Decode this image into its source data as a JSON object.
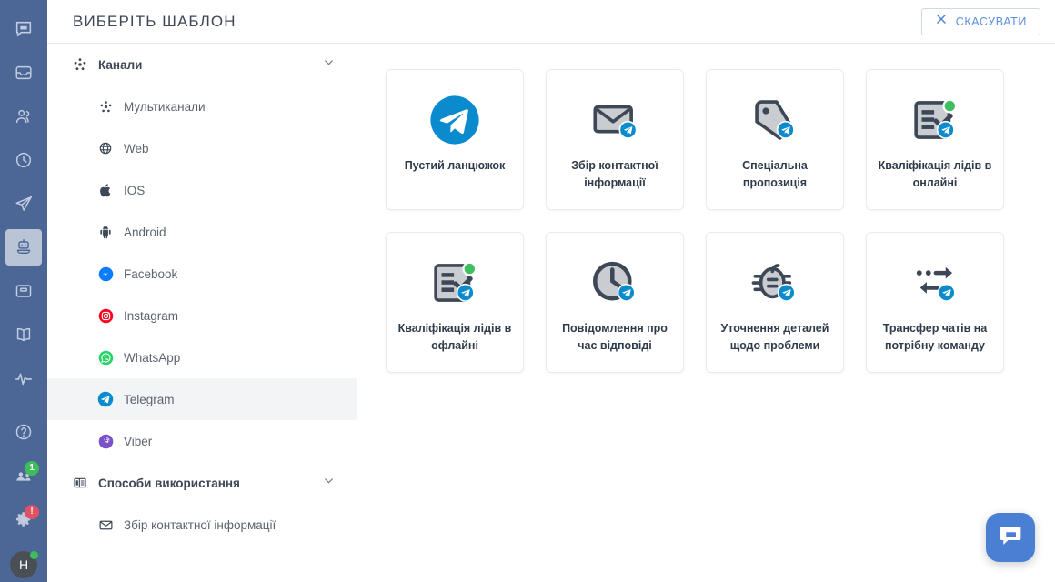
{
  "header": {
    "title": "ВИБЕРІТЬ ШАБЛОН",
    "cancel_label": "СКАСУВАТИ",
    "cancel_icon": "close-icon"
  },
  "rail": {
    "top_items": [
      {
        "name": "chat-icon",
        "active": false
      },
      {
        "name": "inbox-icon",
        "active": false
      },
      {
        "name": "contacts-icon",
        "active": false
      },
      {
        "name": "history-icon",
        "active": false
      },
      {
        "name": "broadcast-icon",
        "active": false
      },
      {
        "name": "bot-icon",
        "active": true
      },
      {
        "name": "archive-icon",
        "active": false
      },
      {
        "name": "knowledge-base-icon",
        "active": false
      },
      {
        "name": "analytics-icon",
        "active": false
      }
    ],
    "bottom_items": [
      {
        "name": "help-icon",
        "badge": null,
        "badge_color": null
      },
      {
        "name": "team-icon",
        "badge": "1",
        "badge_color": "green"
      },
      {
        "name": "settings-icon",
        "badge": "!",
        "badge_color": "red"
      }
    ],
    "avatar_initial": "H"
  },
  "sidebar": {
    "sections": [
      {
        "label": "Канали",
        "icon": "multichannel-icon",
        "chevron": "chevron-down-icon",
        "items": [
          {
            "label": "Мультиканали",
            "icon": "multichannel-icon",
            "selected": false
          },
          {
            "label": "Web",
            "icon": "globe-icon",
            "selected": false
          },
          {
            "label": "IOS",
            "icon": "apple-icon",
            "selected": false
          },
          {
            "label": "Android",
            "icon": "android-icon",
            "selected": false
          },
          {
            "label": "Facebook",
            "icon": "facebook-messenger-icon",
            "selected": false
          },
          {
            "label": "Instagram",
            "icon": "instagram-icon",
            "selected": false
          },
          {
            "label": "WhatsApp",
            "icon": "whatsapp-icon",
            "selected": false
          },
          {
            "label": "Telegram",
            "icon": "telegram-icon",
            "selected": true
          },
          {
            "label": "Viber",
            "icon": "viber-icon",
            "selected": false
          }
        ]
      },
      {
        "label": "Способи використання",
        "icon": "usecases-icon",
        "chevron": "chevron-down-icon",
        "items": [
          {
            "label": "Збір контактної інформації",
            "icon": "envelope-icon",
            "selected": false
          }
        ]
      }
    ]
  },
  "templates": [
    {
      "label": "Пустий ланцюжок",
      "icon": "telegram-logo-icon"
    },
    {
      "label": "Збір контактної інформації",
      "icon": "envelope-telegram-icon"
    },
    {
      "label": "Спеціальна пропозиція",
      "icon": "tag-telegram-icon"
    },
    {
      "label": "Кваліфікація лідів в онлайні",
      "icon": "checklist-online-telegram-icon"
    },
    {
      "label": "Кваліфікація лідів в офлайні",
      "icon": "checklist-offline-telegram-icon"
    },
    {
      "label": "Повідомлення про час відповіді",
      "icon": "clock-telegram-icon"
    },
    {
      "label": "Уточнення деталей щодо проблеми",
      "icon": "bug-telegram-icon"
    },
    {
      "label": "Трансфер чатів на потрібну команду",
      "icon": "transfer-telegram-icon"
    }
  ],
  "chat_widget": {
    "icon": "chat-bubble-icon"
  },
  "colors": {
    "rail_bg": "#4c6796",
    "accent_blue": "#5b8fe0",
    "telegram_blue": "#0a8bcd",
    "selected_row": "#f3f4f5",
    "widget_blue": "#4a7fd4"
  }
}
